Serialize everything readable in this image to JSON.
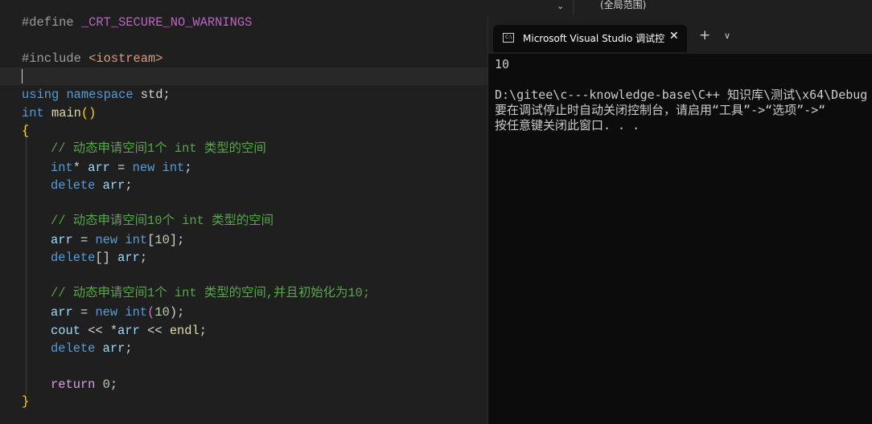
{
  "editor": {
    "lines": {
      "l1a": "#define ",
      "l1b": "_CRT_SECURE_NO_WARNINGS",
      "l3a": "#include ",
      "l3b": "<iostream>",
      "l5a": "using",
      "l5b": " ",
      "l5c": "namespace",
      "l5d": " std;",
      "l6a": "int",
      "l6b": " ",
      "l6c": "main",
      "l6d": "()",
      "l7a": "{",
      "l8": "// 动态申请空间1个 int 类型的空间",
      "l9a": "int",
      "l9b": "* ",
      "l9c": "arr",
      "l9d": " = ",
      "l9e": "new",
      "l9f": " ",
      "l9g": "int",
      "l9h": ";",
      "l10a": "delete",
      "l10b": " ",
      "l10c": "arr",
      "l10d": ";",
      "l12": "// 动态申请空间10个 int 类型的空间",
      "l13a": "arr",
      "l13b": " = ",
      "l13c": "new",
      "l13d": " ",
      "l13e": "int",
      "l13f": "[",
      "l13g": "10",
      "l13h": "];",
      "l14a": "delete",
      "l14b": "[] ",
      "l14c": "arr",
      "l14d": ";",
      "l16": "// 动态申请空间1个 int 类型的空间,并且初始化为10;",
      "l17a": "arr",
      "l17b": " = ",
      "l17c": "new",
      "l17d": " ",
      "l17e": "int",
      "l17f": "(",
      "l17g": "10",
      "l17h": ");",
      "l18a": "cout",
      "l18b": " << *",
      "l18c": "arr",
      "l18d": " << ",
      "l18e": "endl",
      "l18f": ";",
      "l19a": "delete",
      "l19b": " ",
      "l19c": "arr",
      "l19d": ";",
      "l21a": "return",
      "l21b": " ",
      "l21c": "0",
      "l21d": ";",
      "l22a": "}"
    }
  },
  "toolbar": {
    "dropdown_icon": "chevron-down-icon",
    "scope_label": "(全局范围)"
  },
  "terminal": {
    "tab_title": "Microsoft Visual Studio 调试控",
    "tab_icon": "console-icon",
    "tab_icon_text": "C:\\",
    "close_icon": "close-icon",
    "new_tab_label": "+",
    "dropdown_label": "∨",
    "output": [
      "10",
      "",
      "D:\\gitee\\c---knowledge-base\\C++ 知识库\\测试\\x64\\Debug",
      "要在调试停止时自动关闭控制台，请启用“工具”->“选项”->“",
      "按任意键关闭此窗口. . ."
    ]
  },
  "colors": {
    "editor_bg": "#1f1f1f",
    "terminal_bg": "#0c0c0c",
    "keyword": "#569cd6",
    "comment": "#57a64a",
    "number": "#b5cea8",
    "variable": "#9cdcfe"
  }
}
